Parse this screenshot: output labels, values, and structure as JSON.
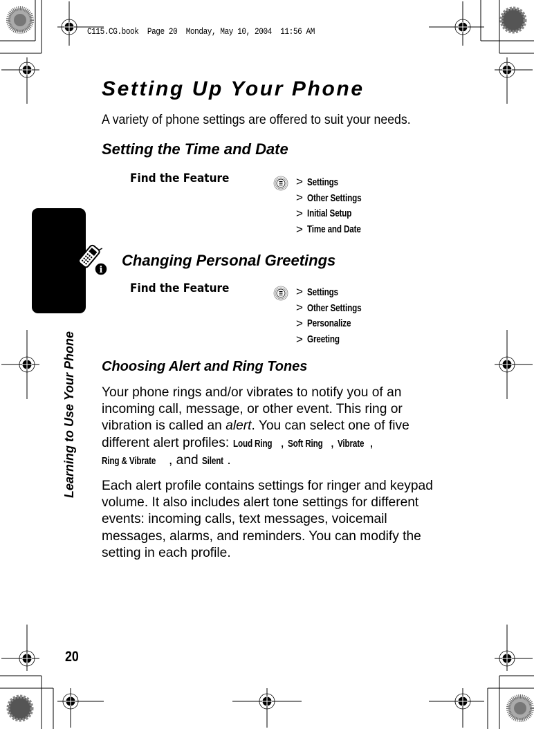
{
  "print_header": "C115.CG.book  Page 20  Monday, May 10, 2004  11:56 AM",
  "page_title": "Setting Up Your Phone",
  "intro": "A variety of phone settings are offered to suit your needs.",
  "sections": [
    {
      "heading": "Setting the Time and Date",
      "find_feature_label": "Find the Feature",
      "menu_icon": "menu-key-icon",
      "path": [
        "Settings",
        "Other Settings",
        "Initial Setup",
        "Time and Date"
      ]
    },
    {
      "heading": "Changing Personal Greetings",
      "find_feature_label": "Find the Feature",
      "menu_icon": "menu-key-icon",
      "path": [
        "Settings",
        "Other Settings",
        "Personalize",
        "Greeting"
      ]
    },
    {
      "heading": "Choosing Alert and Ring Tones",
      "paragraph1": {
        "part1": "Your phone rings and/or vibrates to notify you of an incoming call, message, or other event. This ring or vibration is called an ",
        "emphasis": "alert",
        "part2": ". You can select one of five different alert profiles: ",
        "profiles": [
          "Loud Ring",
          "Soft Ring",
          "Vibrate",
          "Ring & Vibrate",
          "Silent"
        ],
        "sep": ", ",
        "and": "and ",
        "end": "."
      },
      "paragraph2": "Each alert profile contains settings for ringer and keypad volume. It also includes alert tone settings for different events: incoming calls, text messages, voicemail messages, alarms, and reminders. You can modify the setting in each profile."
    }
  ],
  "menu_separator": ">",
  "side_tab": {
    "icon": "phone-info-icon",
    "label": "Learning to Use Your Phone"
  },
  "page_number": "20"
}
